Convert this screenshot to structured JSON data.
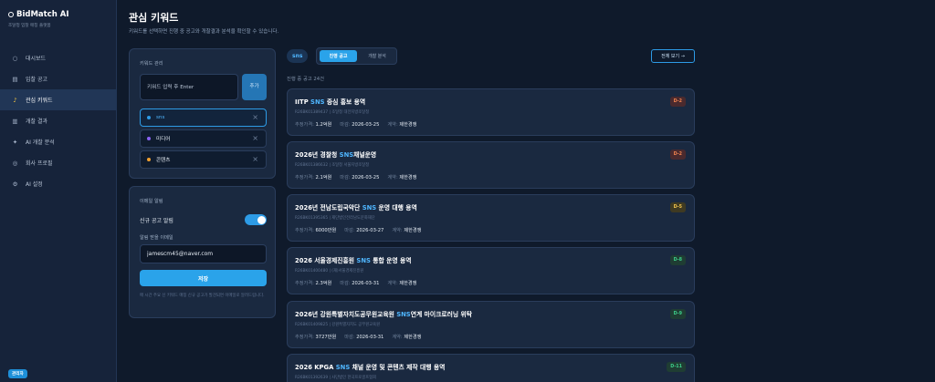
{
  "app": {
    "name": "BidMatch AI",
    "subtitle": "조달청 입찰 매칭 플랫폼"
  },
  "sidebar": {
    "items": [
      {
        "label": "대시보드",
        "icon": "circle-icon",
        "active": false
      },
      {
        "label": "입찰 공고",
        "icon": "clipboard-icon",
        "active": false
      },
      {
        "label": "관심 키워드",
        "icon": "bell-icon",
        "active": true
      },
      {
        "label": "개찰 결과",
        "icon": "chart-icon",
        "active": false
      },
      {
        "label": "AI 개찰 분석",
        "icon": "sparkle-icon",
        "active": false
      },
      {
        "label": "회사 프로필",
        "icon": "gear-icon",
        "active": false
      },
      {
        "label": "AI 설정",
        "icon": "settings-icon",
        "active": false
      }
    ],
    "admin_badge": "관리자"
  },
  "header": {
    "title": "관심 키워드",
    "description": "키워드를 선택하면 진행 중 공고와 개찰결과 분석을 확인할 수 있습니다."
  },
  "keyword_panel": {
    "title": "키워드 관리",
    "input_placeholder": "키워드 입력 후 Enter",
    "add_label": "추가",
    "keywords": [
      {
        "label": "sns",
        "color": "#2d9be6",
        "selected": true
      },
      {
        "label": "미디어",
        "color": "#8a63f2",
        "selected": false
      },
      {
        "label": "콘텐츠",
        "color": "#f0a030",
        "selected": false
      }
    ]
  },
  "email_panel": {
    "title": "이메일 알림",
    "toggle_label": "신규 공고 알림",
    "toggle_on": true,
    "email_label": "알림 받을 이메일",
    "email_value": "jamescm45@naver.com",
    "save_label": "저장",
    "note": "매 시간 주요 신 키워드 매칭 신규 공고가 발견되면 이메일로 알려드립니다."
  },
  "results": {
    "active_keyword": "sns",
    "tabs": [
      {
        "label": "진행 공고",
        "active": true
      },
      {
        "label": "개찰 분석",
        "active": false
      }
    ],
    "view_all_label": "전체 보기 →",
    "count_text": "진행 중 공고 24건",
    "cards": [
      {
        "pre": "IITP ",
        "hl": "SNS",
        "post": " 중심 홍보 용역",
        "sub": "R26BK01389437 | 조달청 대전지방조달청",
        "price_label": "추정가격:",
        "price": "1.2억원",
        "due_label": "마감:",
        "due": "2026-03-25",
        "contract_label": "계약:",
        "contract": "제한경쟁",
        "dday": "D-2",
        "dday_color": "red"
      },
      {
        "pre": "2026년 경찰청 ",
        "hl": "SNS",
        "post": "채널운영",
        "sub": "R26BK01386632 | 조달청 서울지방조달청",
        "price_label": "추정가격:",
        "price": "2.1억원",
        "due_label": "마감:",
        "due": "2026-03-25",
        "contract_label": "계약:",
        "contract": "제한경쟁",
        "dday": "D-2",
        "dday_color": "red"
      },
      {
        "pre": "2026년 전남도립국악단 ",
        "hl": "SNS",
        "post": " 운영 대행 용역",
        "sub": "R26BK01395365 | 재단법인전라남도문화재단",
        "price_label": "추정가격:",
        "price": "6000만원",
        "due_label": "마감:",
        "due": "2026-03-27",
        "contract_label": "계약:",
        "contract": "제한경쟁",
        "dday": "D-5",
        "dday_color": "yellow"
      },
      {
        "pre": "2026 서울경제진흥원 ",
        "hl": "SNS",
        "post": " 통합 운영 용역",
        "sub": "R26BK01400480 | (재)서울경제진흥원",
        "price_label": "추정가격:",
        "price": "2.3억원",
        "due_label": "마감:",
        "due": "2026-03-31",
        "contract_label": "계약:",
        "contract": "제한경쟁",
        "dday": "D-8",
        "dday_color": "green"
      },
      {
        "pre": "2026년 강원특별자치도공무원교육원 ",
        "hl": "SNS",
        "post": "연계 마이크로러닝 위탁",
        "sub": "R26BK01409825 | 강원특별자치도 공무원교육원",
        "price_label": "추정가격:",
        "price": "3727만원",
        "due_label": "마감:",
        "due": "2026-03-31",
        "contract_label": "계약:",
        "contract": "제한경쟁",
        "dday": "D-9",
        "dday_color": "green"
      },
      {
        "pre": "2026 KPGA ",
        "hl": "SNS",
        "post": " 채널 운영 및 콘텐츠 제작 대행 용역",
        "sub": "R26BK01392639 | 사단법인 한국프로골프협회",
        "price_label": "",
        "price": "",
        "due_label": "",
        "due": "",
        "contract_label": "",
        "contract": "",
        "dday": "D-11",
        "dday_color": "green"
      }
    ]
  }
}
